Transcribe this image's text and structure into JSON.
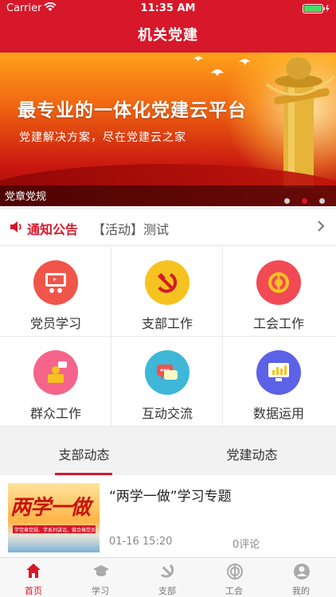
{
  "status_bar": {
    "carrier": "Carrier",
    "time": "11:35 AM"
  },
  "nav": {
    "title": "机关党建"
  },
  "banner": {
    "headline": "最专业的一体化党建云平台",
    "subtitle": "党建解决方案，尽在党建云之家",
    "caption": "党章党规",
    "page_count": 3,
    "active_page": 2
  },
  "notice": {
    "title": "通知公告",
    "text": "【活动】测试"
  },
  "grid": [
    {
      "label": "党员学习",
      "icon": "monitor-lecture-icon",
      "color": "#f0554a"
    },
    {
      "label": "支部工作",
      "icon": "hammer-sickle-icon",
      "color": "#f6c21f"
    },
    {
      "label": "工会工作",
      "icon": "union-emblem-icon",
      "color": "#f24a55"
    },
    {
      "label": "群众工作",
      "icon": "person-chat-icon",
      "color": "#f5648a"
    },
    {
      "label": "互动交流",
      "icon": "chat-bubbles-icon",
      "color": "#3fb7d8"
    },
    {
      "label": "数据运用",
      "icon": "bar-chart-monitor-icon",
      "color": "#5b62e6"
    }
  ],
  "tabs": [
    {
      "label": "支部动态",
      "active": true
    },
    {
      "label": "党建动态",
      "active": false
    }
  ],
  "news": {
    "title": "“两学一做”学习专题",
    "date": "01-16 15:20",
    "comments": "0评论",
    "thumb_text": "两学一做",
    "thumb_strip": "学党章党规、学系列讲话，做合格党员"
  },
  "tabbar": [
    {
      "label": "首页",
      "icon": "home-icon",
      "active": true
    },
    {
      "label": "学习",
      "icon": "graduation-cap-icon",
      "active": false
    },
    {
      "label": "支部",
      "icon": "hammer-sickle-icon",
      "active": false
    },
    {
      "label": "工会",
      "icon": "union-emblem-icon",
      "active": false
    },
    {
      "label": "我的",
      "icon": "user-icon",
      "active": false
    }
  ],
  "colors": {
    "primary": "#d6182a",
    "background": "#f2f2f2"
  }
}
